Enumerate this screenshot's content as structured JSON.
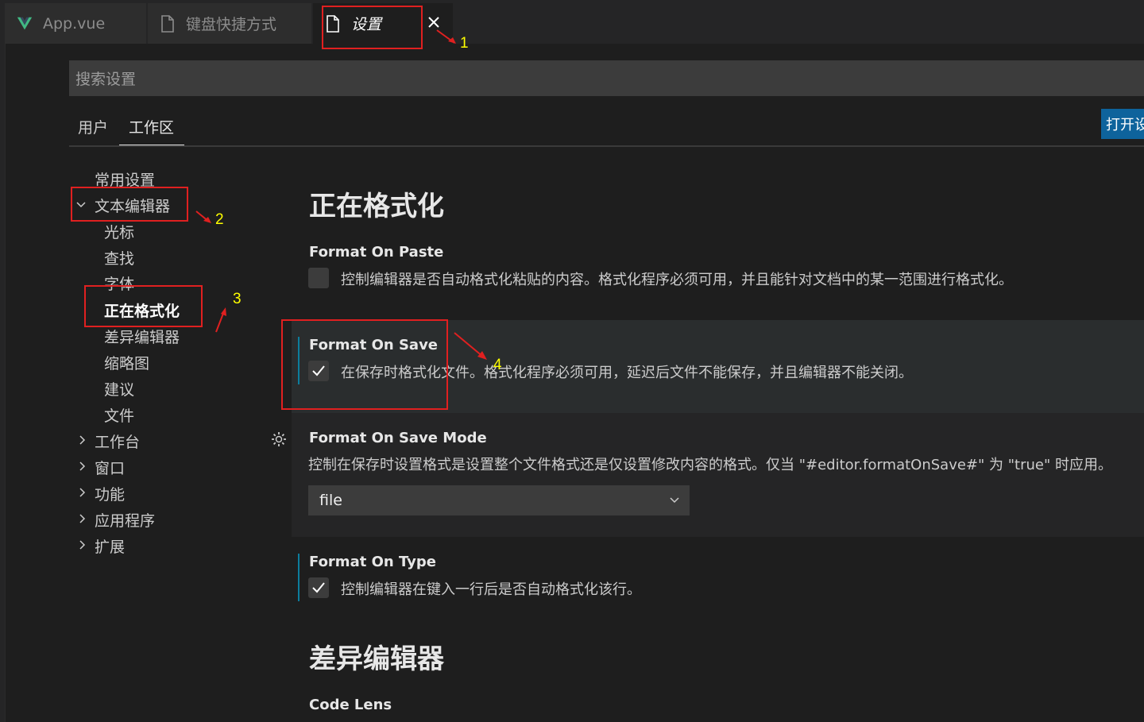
{
  "tabs": [
    {
      "label": "App.vue",
      "icon": "vue-icon"
    },
    {
      "label": "键盘快捷方式",
      "icon": "file-icon"
    },
    {
      "label": "设置",
      "icon": "file-icon",
      "active": true
    }
  ],
  "search": {
    "placeholder": "搜索设置"
  },
  "scopes": {
    "user": "用户",
    "workspace": "工作区",
    "open_json": "打开设"
  },
  "toc": {
    "common": "常用设置",
    "text_editor": "文本编辑器",
    "cursor": "光标",
    "find": "查找",
    "font": "字体",
    "formatting": "正在格式化",
    "diff_editor": "差异编辑器",
    "minimap": "缩略图",
    "suggestions": "建议",
    "files": "文件",
    "workbench": "工作台",
    "window": "窗口",
    "features": "功能",
    "application": "应用程序",
    "extensions": "扩展"
  },
  "section_formatting": "正在格式化",
  "settings": {
    "format_on_paste": {
      "title": "Format On Paste",
      "desc": "控制编辑器是否自动格式化粘贴的内容。格式化程序必须可用，并且能针对文档中的某一范围进行格式化。",
      "checked": false
    },
    "format_on_save": {
      "title": "Format On Save",
      "desc": "在保存时格式化文件。格式化程序必须可用，延迟后文件不能保存，并且编辑器不能关闭。",
      "checked": true
    },
    "format_on_save_mode": {
      "title": "Format On Save Mode",
      "desc": "控制在保存时设置格式是设置整个文件格式还是仅设置修改内容的格式。仅当 \"#editor.formatOnSave#\" 为 \"true\" 时应用。",
      "value": "file"
    },
    "format_on_type": {
      "title": "Format On Type",
      "desc": "控制编辑器在键入一行后是否自动格式化该行。",
      "checked": true
    }
  },
  "section_diff": "差异编辑器",
  "code_lens": {
    "title": "Code Lens"
  },
  "annotations": [
    "1",
    "2",
    "3",
    "4"
  ],
  "colors": {
    "background": "#1e1e1e",
    "accent": "#0e639c",
    "annotation": "#e02020",
    "annotation_text": "#ffff00"
  }
}
